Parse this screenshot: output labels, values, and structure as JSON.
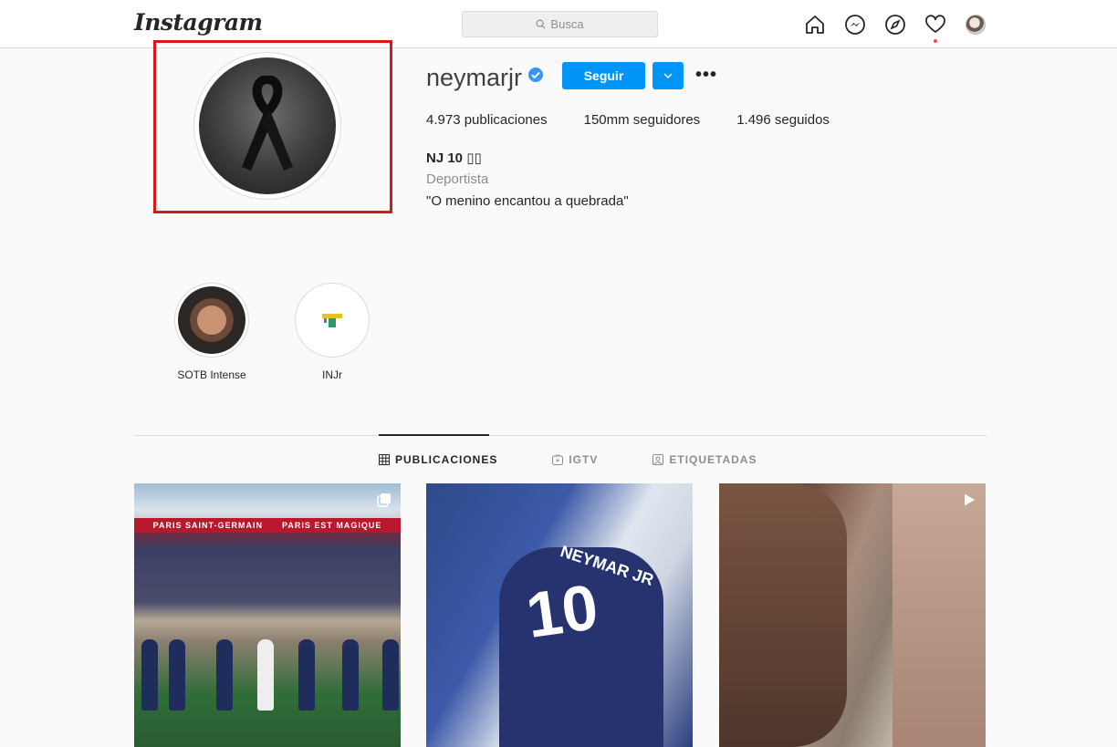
{
  "topbar": {
    "logo": "Instagram",
    "search_placeholder": "Busca",
    "icons": [
      "home-icon",
      "messenger-icon",
      "explore-icon",
      "heart-icon",
      "profile-avatar"
    ]
  },
  "profile": {
    "username": "neymarjr",
    "verified": true,
    "follow_label": "Seguir",
    "more_label": "•••",
    "stats": {
      "posts": "4.973 publicaciones",
      "followers": "150mm seguidores",
      "following": "1.496 seguidos"
    },
    "full_name": "NJ 10 ▯▯",
    "category": "Deportista",
    "bio": "\"O menino encantou a quebrada\""
  },
  "highlights": [
    {
      "label": "SOTB Intense"
    },
    {
      "label": "INJr"
    }
  ],
  "tabs": [
    {
      "label": "PUBLICACIONES",
      "active": true
    },
    {
      "label": "IGTV",
      "active": false
    },
    {
      "label": "ETIQUETADAS",
      "active": false
    }
  ],
  "posts": [
    {
      "banner_left": "PARIS SAINT-GERMAIN",
      "banner_right": "PARIS EST MAGIQUE",
      "badge": "multi-photo-icon"
    },
    {
      "jersey_number": "10",
      "jersey_name": "NEYMAR JR",
      "badge": "none"
    },
    {
      "badge": "video-icon"
    }
  ],
  "colors": {
    "accent": "#0095f6",
    "highlight_box": "#d9161c",
    "notification_dot": "#ed4956"
  }
}
